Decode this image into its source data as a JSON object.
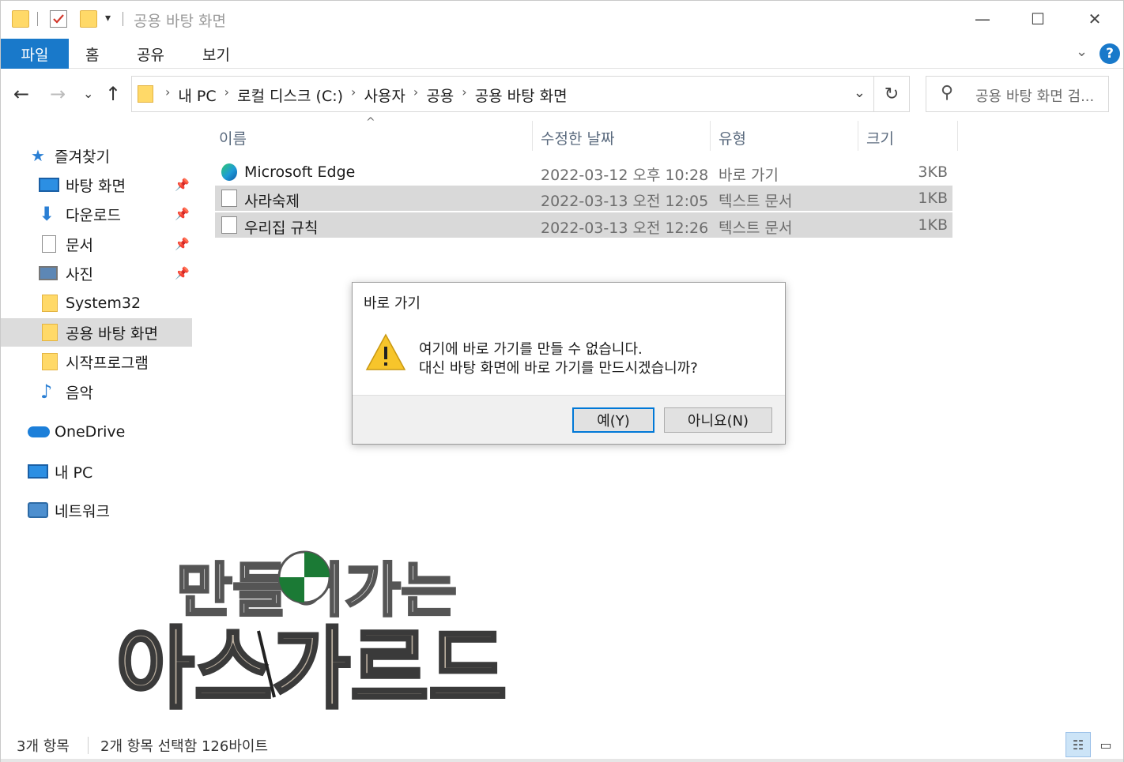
{
  "window": {
    "title": "공용 바탕 화면",
    "minimize_glyph": "—",
    "maximize_glyph": "☐",
    "close_glyph": "✕"
  },
  "ribbon": {
    "tabs": [
      "파일",
      "홈",
      "공유",
      "보기"
    ],
    "help_glyph": "?",
    "expand_glyph": "⌄"
  },
  "nav": {
    "back": "←",
    "forward": "→",
    "recent": "⌄",
    "up": "↑",
    "breadcrumb": [
      "내 PC",
      "로컬 디스크 (C:)",
      "사용자",
      "공용",
      "공용 바탕 화면"
    ],
    "separator": "›",
    "dropdown_glyph": "⌄",
    "refresh_glyph": "↻",
    "search_placeholder": "공용 바탕 화면 검...",
    "search_glyph": "⚲"
  },
  "sidebar": {
    "items": [
      {
        "label": "즐겨찾기",
        "icon": "star-icon",
        "pinned": false
      },
      {
        "label": "바탕 화면",
        "icon": "desktop-icon",
        "pinned": true
      },
      {
        "label": "다운로드",
        "icon": "download-icon",
        "pinned": true
      },
      {
        "label": "문서",
        "icon": "document-icon",
        "pinned": true
      },
      {
        "label": "사진",
        "icon": "picture-icon",
        "pinned": true
      },
      {
        "label": "System32",
        "icon": "folder-icon",
        "pinned": false
      },
      {
        "label": "공용 바탕 화면",
        "icon": "folder-icon",
        "pinned": false,
        "selected": true
      },
      {
        "label": "시작프로그램",
        "icon": "folder-icon",
        "pinned": false
      },
      {
        "label": "음악",
        "icon": "music-icon",
        "pinned": false
      },
      {
        "label": "OneDrive",
        "icon": "cloud-icon",
        "pinned": false
      },
      {
        "label": "내 PC",
        "icon": "computer-icon",
        "pinned": false
      },
      {
        "label": "네트워크",
        "icon": "network-icon",
        "pinned": false
      }
    ],
    "pin_glyph": "📌"
  },
  "columns": [
    "이름",
    "수정한 날짜",
    "유형",
    "크기"
  ],
  "sort_glyph": "^",
  "files": [
    {
      "name": "Microsoft Edge",
      "date": "2022-03-12 오후 10:28",
      "type": "바로 가기",
      "size": "3KB",
      "icon": "edge-icon",
      "selected": false
    },
    {
      "name": "사라숙제",
      "date": "2022-03-13 오전 12:05",
      "type": "텍스트 문서",
      "size": "1KB",
      "icon": "text-file-icon",
      "selected": true
    },
    {
      "name": "우리집 규칙",
      "date": "2022-03-13 오전 12:26",
      "type": "텍스트 문서",
      "size": "1KB",
      "icon": "text-file-icon",
      "selected": true
    }
  ],
  "dialog": {
    "title": "바로 가기",
    "message_line1": "여기에 바로 가기를 만들 수 없습니다.",
    "message_line2": "대신 바탕 화면에 바로 가기를 만드시겠습니까?",
    "yes": "예(Y)",
    "no": "아니요(N)"
  },
  "watermark": {
    "line1": "만들어가는",
    "line2": "아스가르드"
  },
  "status": {
    "item_count": "3개 항목",
    "selection": "2개 항목 선택함 126바이트"
  },
  "colors": {
    "accent": "#1979ca",
    "selection": "#d9d9d9",
    "folder": "#ffd968"
  }
}
